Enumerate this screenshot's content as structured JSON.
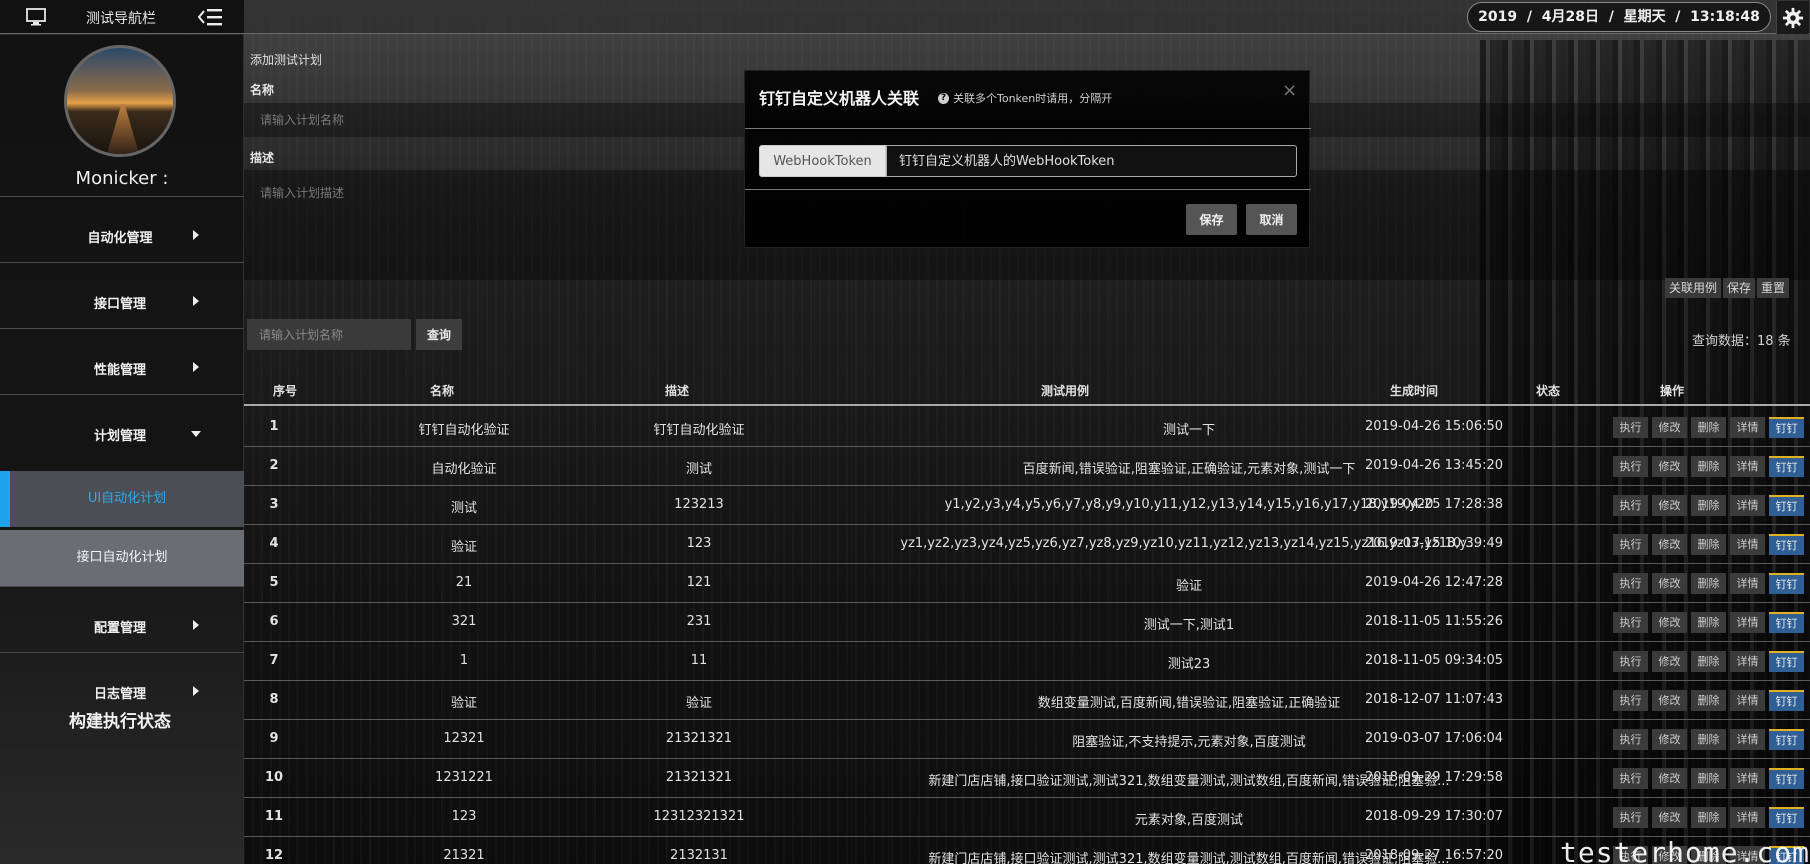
{
  "topbar": {
    "nav_title": "测试导航栏",
    "datetime": "2019  /  4月28日  /  星期天  /  13:18:48"
  },
  "sidebar": {
    "username": "Monicker :",
    "menu": [
      {
        "label": "自动化管理",
        "expanded": false
      },
      {
        "label": "接口管理",
        "expanded": false
      },
      {
        "label": "性能管理",
        "expanded": false
      },
      {
        "label": "计划管理",
        "expanded": true
      },
      {
        "label": "配置管理",
        "expanded": false
      },
      {
        "label": "日志管理",
        "expanded": false
      }
    ],
    "submenu": [
      {
        "label": "UI自动化计划",
        "active": true
      },
      {
        "label": "接口自动化计划",
        "active": false
      }
    ],
    "build_status": "构建执行状态"
  },
  "form": {
    "title": "添加测试计划",
    "name_label": "名称",
    "name_placeholder": "请输入计划名称",
    "desc_label": "描述",
    "desc_placeholder": "请输入计划描述",
    "buttons": [
      "关联用例",
      "保存",
      "重置"
    ]
  },
  "search": {
    "placeholder": "请输入计划名称",
    "button": "查询",
    "result_count": "查询数据：18  条"
  },
  "table": {
    "headers": [
      "序号",
      "名称",
      "描述",
      "测试用例",
      "生成时间",
      "状态",
      "操作"
    ],
    "op_labels": [
      "执行",
      "修改",
      "删除",
      "详情",
      "钉钉"
    ],
    "rows": [
      {
        "no": "1",
        "name": "钉钉自动化验证",
        "desc": "钉钉自动化验证",
        "cases": "测试一下",
        "time": "2019-04-26 15:06:50",
        "status": ""
      },
      {
        "no": "2",
        "name": "自动化验证",
        "desc": "测试",
        "cases": "百度新闻,错误验证,阻塞验证,正确验证,元素对象,测试一下",
        "time": "2019-04-26 13:45:20",
        "status": ""
      },
      {
        "no": "3",
        "name": "测试",
        "desc": "123213",
        "cases": "y1,y2,y3,y4,y5,y6,y7,y8,y9,y10,y11,y12,y13,y14,y15,y16,y17,y18,y19,y20",
        "time": "2019-04-25 17:28:38",
        "status": ""
      },
      {
        "no": "4",
        "name": "验证",
        "desc": "123",
        "cases": "yz1,yz2,yz3,yz4,yz5,yz6,yz7,yz8,yz9,yz10,yz11,yz12,yz13,yz14,yz15,yz16,yz17,yz18,y...",
        "time": "2019-03-15 10:39:49",
        "status": ""
      },
      {
        "no": "5",
        "name": "21",
        "desc": "121",
        "cases": "验证",
        "time": "2019-04-26 12:47:28",
        "status": ""
      },
      {
        "no": "6",
        "name": "321",
        "desc": "231",
        "cases": "测试一下,测试1",
        "time": "2018-11-05 11:55:26",
        "status": ""
      },
      {
        "no": "7",
        "name": "1",
        "desc": "11",
        "cases": "测试23",
        "time": "2018-11-05 09:34:05",
        "status": ""
      },
      {
        "no": "8",
        "name": "验证",
        "desc": "验证",
        "cases": "数组变量测试,百度新闻,错误验证,阻塞验证,正确验证",
        "time": "2018-12-07 11:07:43",
        "status": ""
      },
      {
        "no": "9",
        "name": "12321",
        "desc": "21321321",
        "cases": "阻塞验证,不支持提示,元素对象,百度测试",
        "time": "2019-03-07 17:06:04",
        "status": ""
      },
      {
        "no": "10",
        "name": "1231221",
        "desc": "21321321",
        "cases": "新建门店店铺,接口验证测试,测试321,数组变量测试,测试数组,百度新闻,错误验证,阻塞验...",
        "time": "2018-09-29 17:29:58",
        "status": ""
      },
      {
        "no": "11",
        "name": "123",
        "desc": "12312321321",
        "cases": "元素对象,百度测试",
        "time": "2018-09-29 17:30:07",
        "status": ""
      },
      {
        "no": "12",
        "name": "21321",
        "desc": "2132131",
        "cases": "新建门店店铺,接口验证测试,测试321,数组变量测试,测试数组,百度新闻,错误验证,阻塞验...",
        "time": "2018-09-27 16:57:20",
        "status": ""
      }
    ]
  },
  "modal": {
    "title": "钉钉自定义机器人关联",
    "hint": "关联多个Tonken时请用，分隔开",
    "close": "×",
    "addon_label": "WebHookToken",
    "token_placeholder": "钉钉自定义机器人的WebHookToken",
    "save_label": "保存",
    "cancel_label": "取消"
  },
  "watermark": "testerhome.com",
  "colors": {
    "accent_blue": "#1ea4ec",
    "ding_button": "#2f5f95",
    "ding_border": "#e0b020"
  }
}
